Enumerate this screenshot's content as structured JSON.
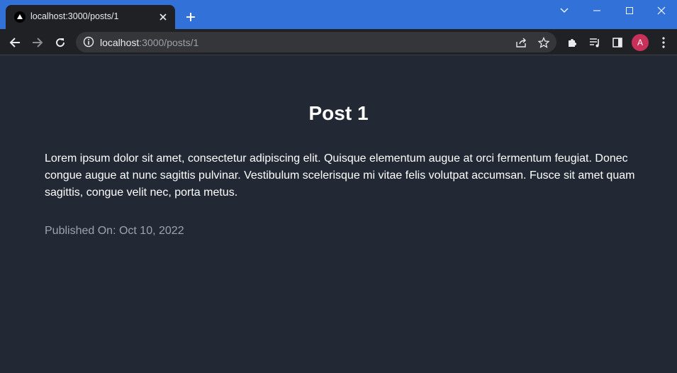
{
  "browser": {
    "tab": {
      "title": "localhost:3000/posts/1"
    },
    "address_bar": {
      "host": "localhost",
      "path": ":3000/posts/1"
    },
    "profile_initial": "A"
  },
  "post": {
    "title": "Post 1",
    "body": "Lorem ipsum dolor sit amet, consectetur adipiscing elit. Quisque elementum augue at orci fermentum feugiat. Donec congue augue at nunc sagittis pulvinar. Vestibulum scelerisque mi vitae felis volutpat accumsan. Fusce sit amet quam sagittis, congue velit nec, porta metus.",
    "published_label": "Published On:",
    "published_date": "Oct 10, 2022"
  }
}
